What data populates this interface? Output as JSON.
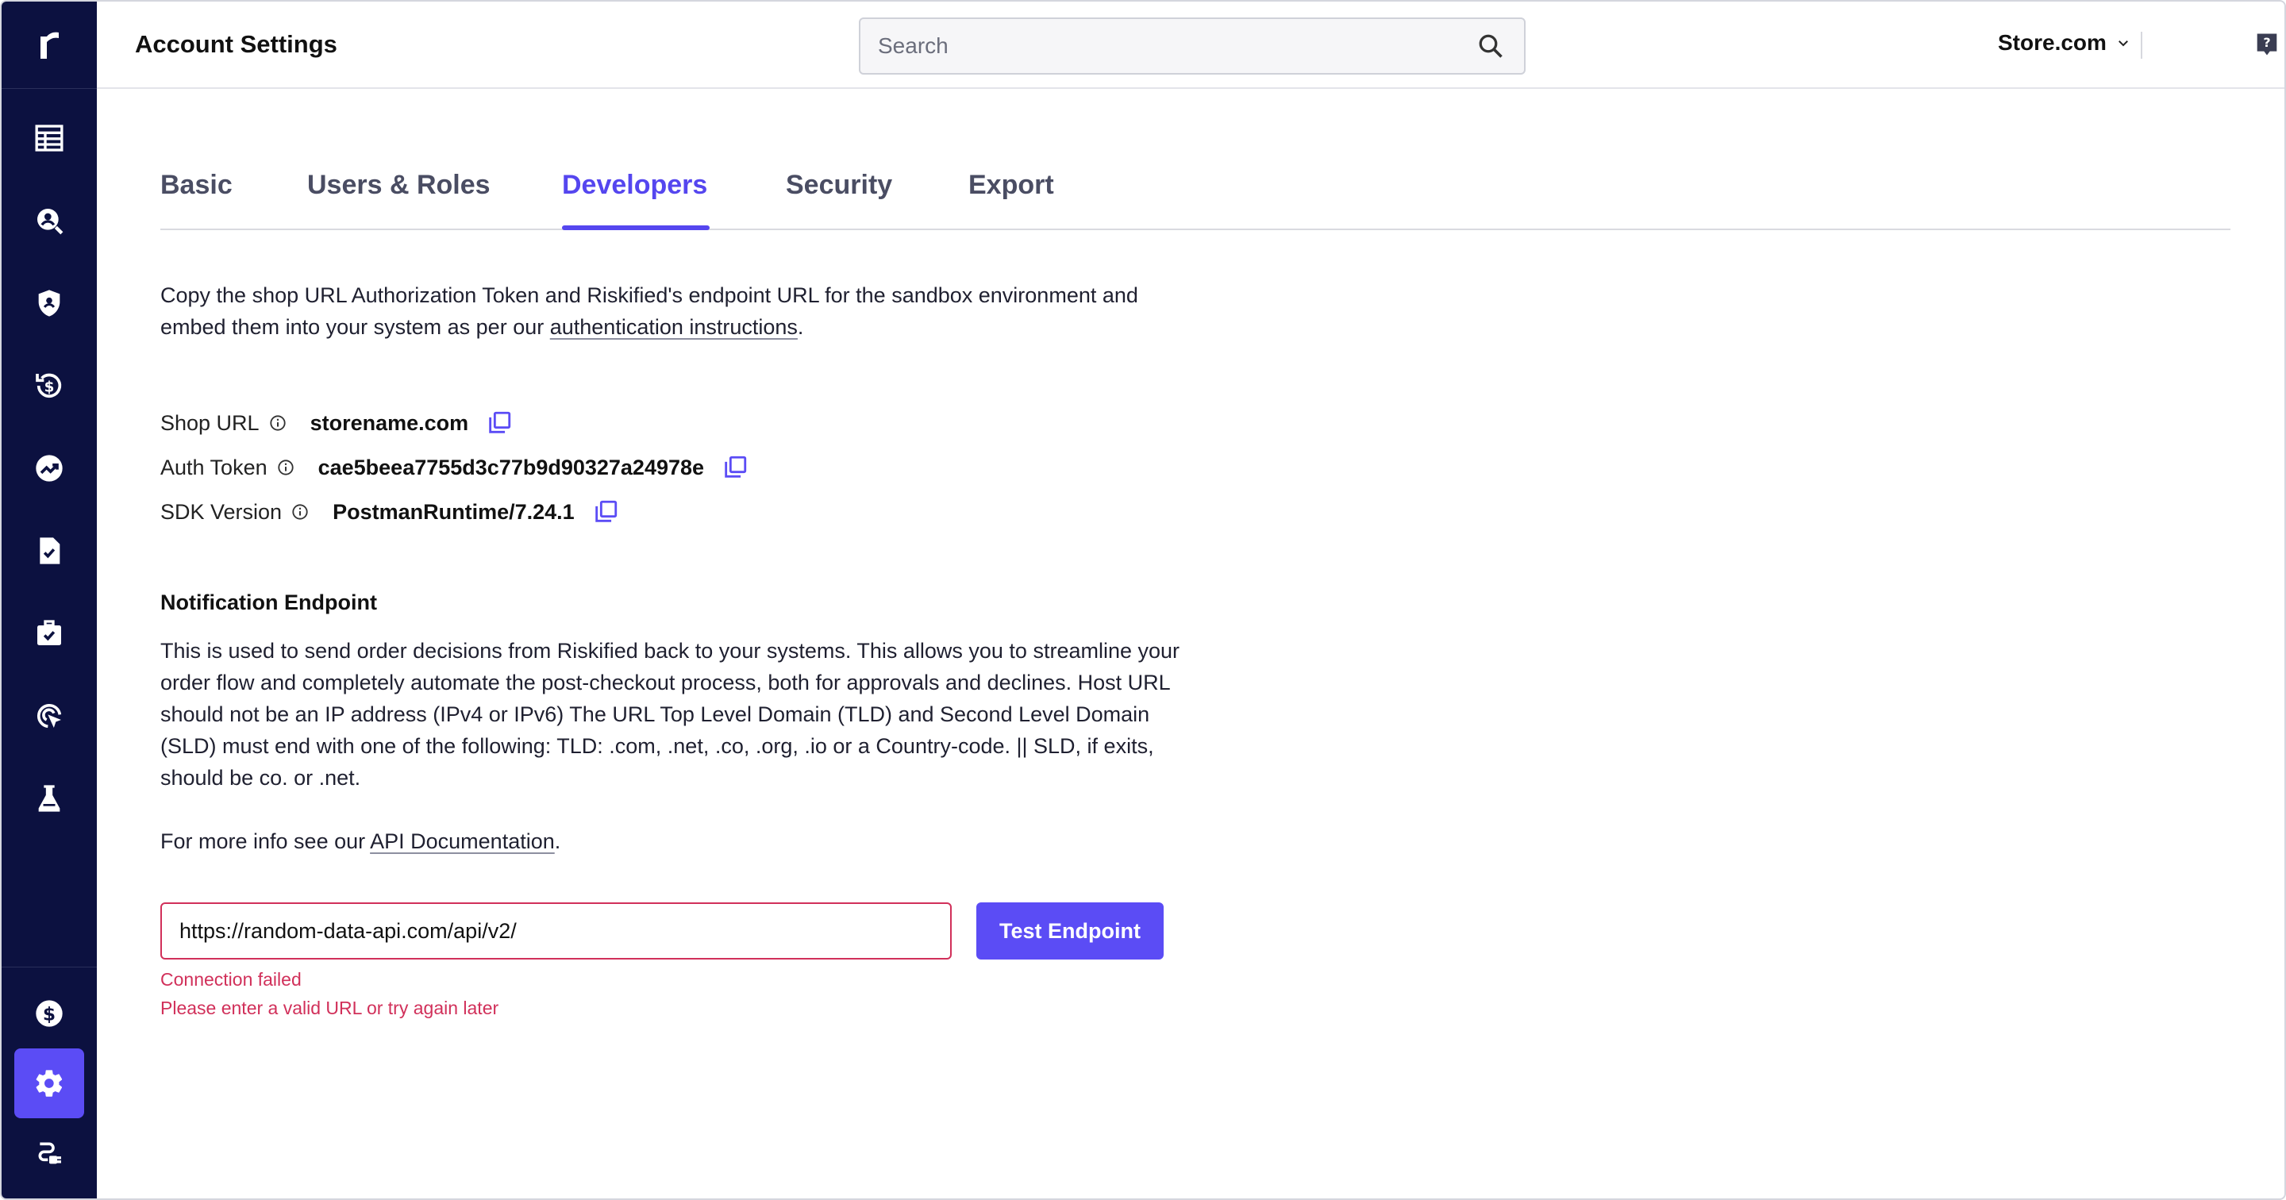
{
  "header": {
    "title": "Account Settings",
    "search_placeholder": "Search",
    "store": "Store.com"
  },
  "sidebar": {
    "items": [
      {
        "icon": "table-icon"
      },
      {
        "icon": "search-user-icon"
      },
      {
        "icon": "shield-icon"
      },
      {
        "icon": "refund-icon"
      },
      {
        "icon": "trending-icon"
      },
      {
        "icon": "document-check-icon"
      },
      {
        "icon": "briefcase-check-icon"
      },
      {
        "icon": "target-cursor-icon"
      },
      {
        "icon": "lab-flask-icon"
      },
      {
        "icon": "billing-dollar-icon"
      },
      {
        "icon": "settings-gear-icon",
        "active": true
      },
      {
        "icon": "integrations-plug-icon"
      }
    ]
  },
  "tabs": [
    {
      "label": "Basic"
    },
    {
      "label": "Users & Roles"
    },
    {
      "label": "Developers",
      "active": true
    },
    {
      "label": "Security"
    },
    {
      "label": "Export"
    }
  ],
  "intro": {
    "text_before": "Copy the shop URL Authorization Token and Riskified's endpoint URL for the sandbox environment and embed them into your system as per our ",
    "link": "authentication instructions",
    "text_after": "."
  },
  "credentials": {
    "shop_url": {
      "label": "Shop URL",
      "value": "storename.com"
    },
    "auth_token": {
      "label": "Auth Token",
      "value": "cae5beea7755d3c77b9d90327a24978e"
    },
    "sdk_version": {
      "label": "SDK Version",
      "value": "PostmanRuntime/7.24.1"
    }
  },
  "notification": {
    "title": "Notification Endpoint",
    "body": "This is used to send order decisions from Riskified back to your systems. This allows you to streamline your order flow and completely automate the post-checkout process, both for approvals and declines. Host URL should not be an IP address (IPv4 or IPv6) The URL Top Level Domain (TLD) and Second Level Domain (SLD) must end with one of the following: TLD: .com, .net, .co, .org, .io or a Country-code. || SLD, if exits, should be co. or .net.",
    "more_info_before": "For more info see our ",
    "more_info_link": "API Documentation",
    "more_info_after": ".",
    "endpoint_value": "https://random-data-api.com/api/v2/",
    "test_button": "Test Endpoint",
    "error_1": "Connection failed",
    "error_2": "Please enter a valid URL or try again later"
  },
  "colors": {
    "sidebar_bg": "#0c1140",
    "accent": "#5b4cf5",
    "error": "#d1305a"
  }
}
